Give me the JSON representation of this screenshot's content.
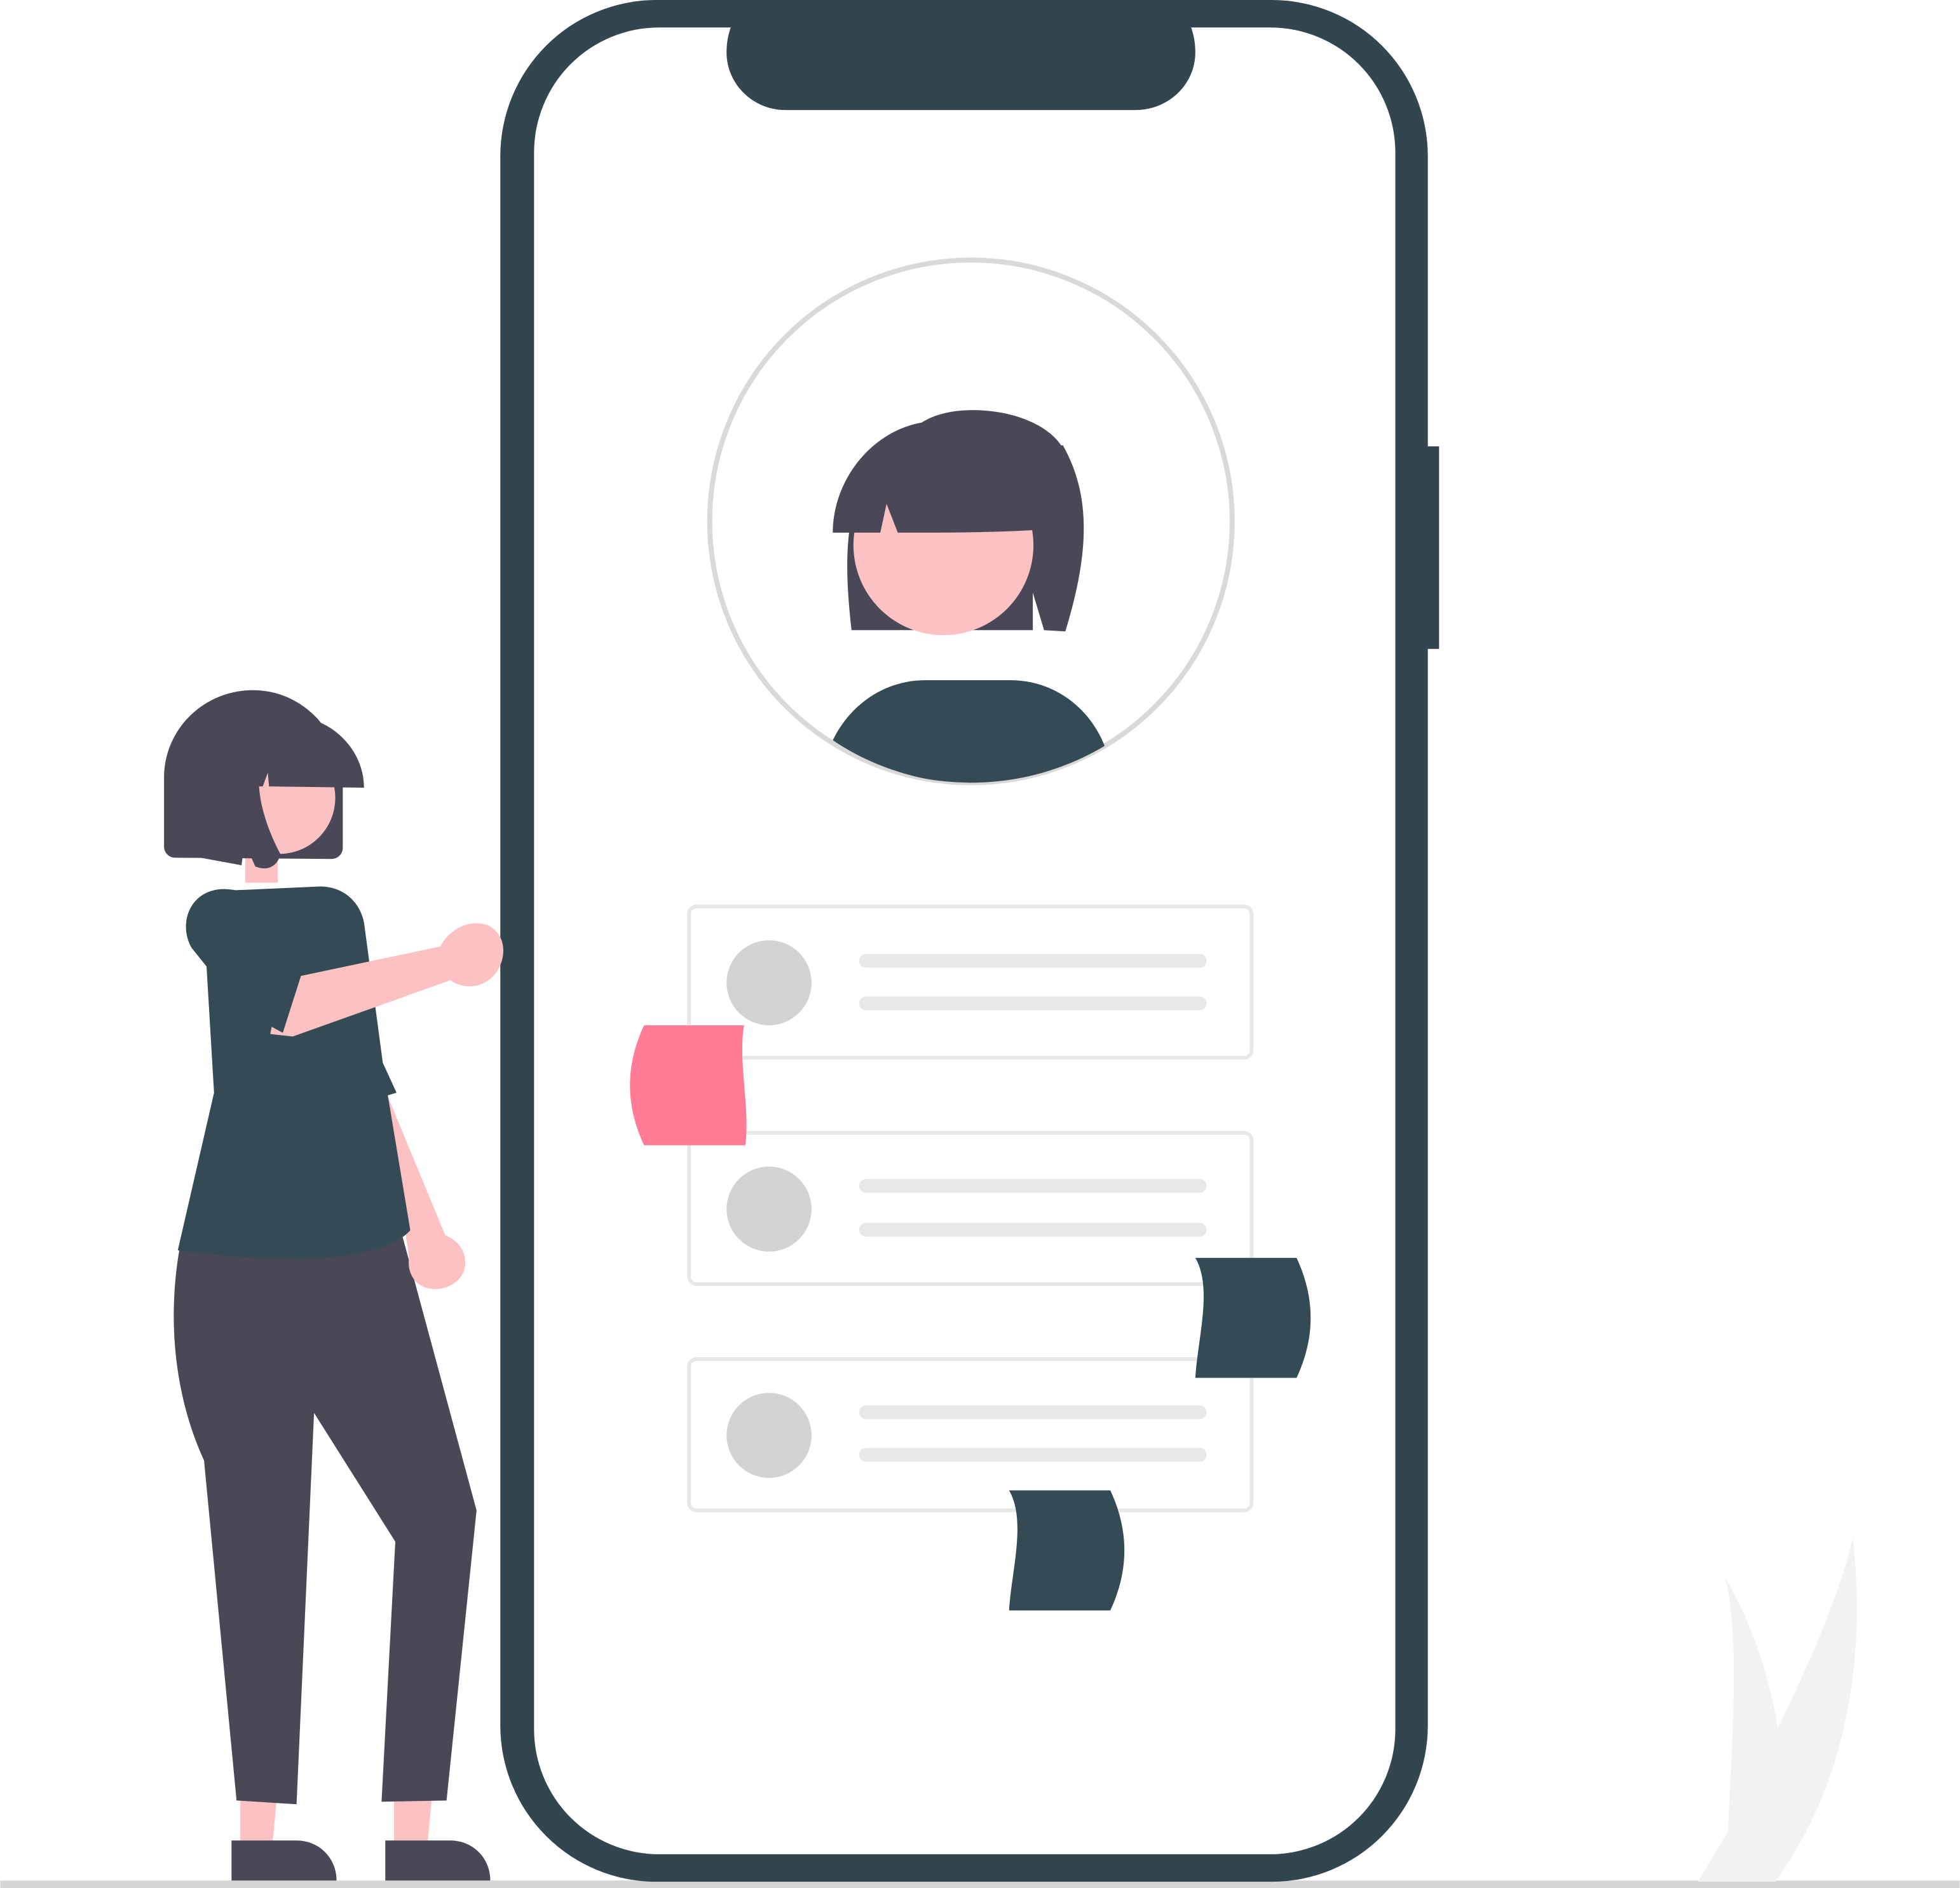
{
  "colors": {
    "background": "#ffffff",
    "phone_frame": "#33454f",
    "phone_screen": "#ffffff",
    "profile_ring": "#d9d9d9",
    "hair": "#4a4857",
    "skin": "#fcc2c3",
    "shirt": "#344b55",
    "pants": "#4a4857",
    "list_card_border": "#e8e8e8",
    "list_avatar": "#d3d3d3",
    "list_line": "#e8e8e8",
    "sticky_note_pink": "#ff7b96",
    "sticky_note_dark": "#344b55",
    "plant": "#f2f2f2",
    "ground": "#d6d6d6"
  },
  "icons": {
    "phone": "smartphone-icon",
    "profile": "user-profile-icon",
    "person": "standing-person-icon",
    "plant": "plant-icon"
  },
  "list_items_count": 3
}
